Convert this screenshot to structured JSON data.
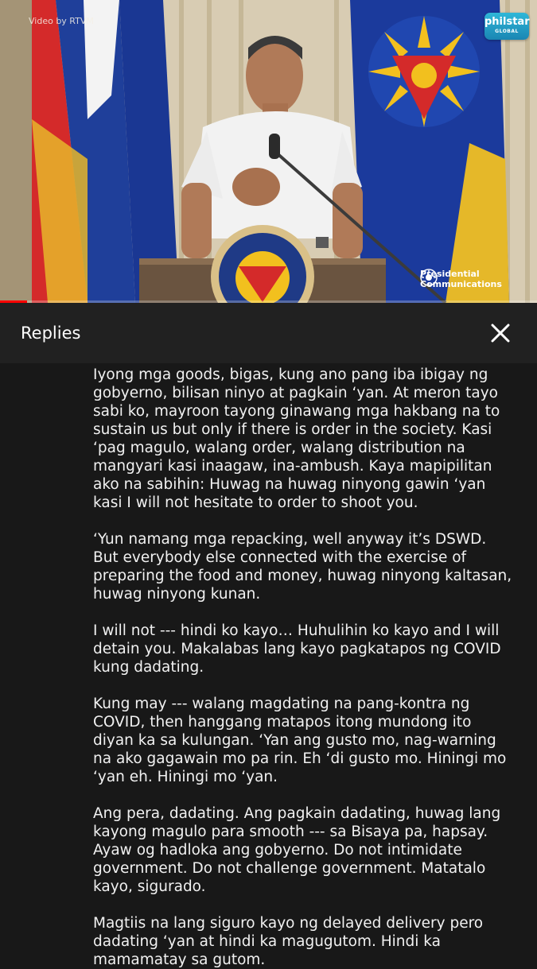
{
  "video": {
    "credit": "Video by RTVM",
    "brand": {
      "line1": "philstar",
      "line2": "GLOBAL"
    },
    "seal_text": "SAGISAG NG PANGULO NG PILIPINAS",
    "watermark": {
      "line1": "Presidential",
      "line2": "Communications"
    },
    "progress_percent": 5,
    "colors": {
      "progress": "#ff0000",
      "flag_blue": "#1f3f9a",
      "flag_red": "#d42a2a",
      "sun_yellow": "#f2c01e"
    }
  },
  "panel": {
    "title": "Replies",
    "close_icon": "close-icon"
  },
  "reply": {
    "paragraphs": [
      "Iyong mga goods, bigas, kung ano pang iba ibigay ng gobyerno, bilisan ninyo at pagkain ‘yan. At meron tayo sabi ko, mayroon tayong ginawang mga hakbang na to sustain us but only if there is order in the society. Kasi ‘pag magulo, walang order, walang distribution na mangyari kasi inaagaw, ina-ambush. Kaya mapipilitan ako na sabihin: Huwag na huwag ninyong gawin ‘yan kasi I will not hesitate to order to shoot you.",
      "‘Yun namang mga repacking, well anyway it’s DSWD. But everybody else connected with the exercise of preparing the food and money, huwag ninyong kaltasan, huwag ninyong kunan.",
      "I will not --- hindi ko kayo… Huhulihin ko kayo and I will detain you. Makalabas lang kayo pagkatapos ng COVID kung dadating.",
      "Kung may --- walang magdating na pang-kontra ng COVID, then hanggang matapos itong mundong ito diyan ka sa kulungan. ‘Yan ang gusto mo, nag-warning na ako gagawain mo pa rin. Eh ‘di gusto mo. Hiningi mo ‘yan eh. Hiningi mo ‘yan.",
      "Ang pera, dadating. Ang pagkain dadating, huwag lang kayong magulo para smooth --- sa Bisaya pa, hapsay. Ayaw og hadloka ang gobyerno. Do not intimidate government. Do not challenge government. Matatalo kayo, sigurado.",
      "Magtiis na lang siguro kayo ng delayed delivery pero dadating ‘yan at hindi ka magugutom. Hindi ka mamamatay sa gutom."
    ]
  }
}
